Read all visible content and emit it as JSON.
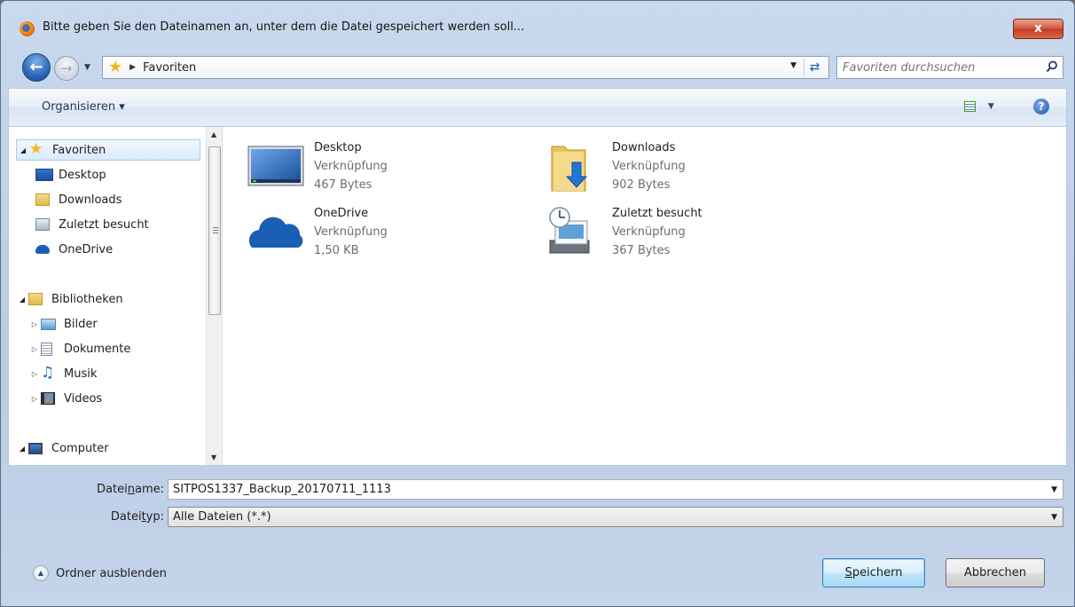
{
  "window": {
    "title": "Bitte geben Sie den Dateinamen an, unter dem die Datei gespeichert werden soll...",
    "close_label": "x"
  },
  "address": {
    "location": "Favoriten",
    "search_placeholder": "Favoriten durchsuchen"
  },
  "toolbar": {
    "organize_label": "Organisieren ▾"
  },
  "navigation": {
    "favorites_header": "Favoriten",
    "favorites": [
      "Desktop",
      "Downloads",
      "Zuletzt besucht",
      "OneDrive"
    ],
    "libraries_header": "Bibliotheken",
    "libraries": [
      "Bilder",
      "Dokumente",
      "Musik",
      "Videos"
    ],
    "computer_header": "Computer"
  },
  "files": [
    {
      "name": "Desktop",
      "type": "Verknüpfung",
      "size": "467 Bytes",
      "icon": "desktop-shortcut-icon"
    },
    {
      "name": "Downloads",
      "type": "Verknüpfung",
      "size": "902 Bytes",
      "icon": "downloads-folder-icon"
    },
    {
      "name": "OneDrive",
      "type": "Verknüpfung",
      "size": "1,50 KB",
      "icon": "onedrive-cloud-icon"
    },
    {
      "name": "Zuletzt besucht",
      "type": "Verknüpfung",
      "size": "367 Bytes",
      "icon": "recent-places-icon"
    }
  ],
  "form": {
    "filename_label_pre": "Datei",
    "filename_label_u": "n",
    "filename_label_post": "ame:",
    "filename_value": "SITPOS1337_Backup_20170711_1113",
    "filetype_label_pre": "Datei",
    "filetype_label_u": "t",
    "filetype_label_post": "yp:",
    "filetype_value": "Alle Dateien (*.*)"
  },
  "footer": {
    "hide_folders_label": "Ordner ausblenden",
    "save_label_u": "S",
    "save_label_rest": "peichern",
    "cancel_label": "Abbrechen"
  },
  "colors": {
    "accent": "#1e5aa8",
    "selection": "#dbeafb"
  }
}
